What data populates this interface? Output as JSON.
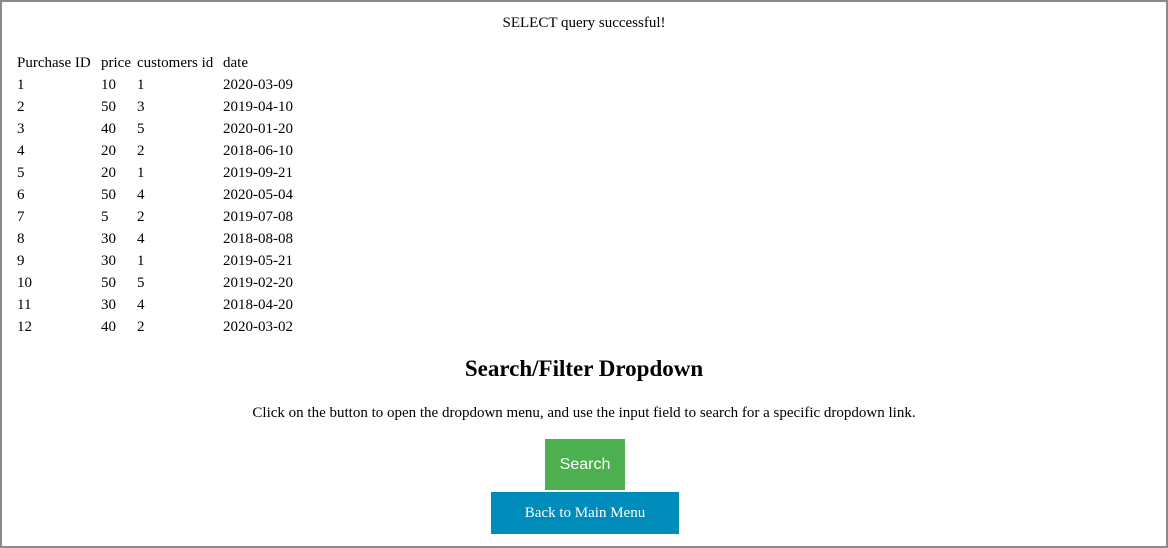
{
  "status_message": "SELECT query successful!",
  "table": {
    "headers": [
      "Purchase ID",
      "price",
      "customers id",
      "date"
    ],
    "rows": [
      [
        "1",
        "10",
        "1",
        "2020-03-09"
      ],
      [
        "2",
        "50",
        "3",
        "2019-04-10"
      ],
      [
        "3",
        "40",
        "5",
        "2020-01-20"
      ],
      [
        "4",
        "20",
        "2",
        "2018-06-10"
      ],
      [
        "5",
        "20",
        "1",
        "2019-09-21"
      ],
      [
        "6",
        "50",
        "4",
        "2020-05-04"
      ],
      [
        "7",
        "5",
        "2",
        "2019-07-08"
      ],
      [
        "8",
        "30",
        "4",
        "2018-08-08"
      ],
      [
        "9",
        "30",
        "1",
        "2019-05-21"
      ],
      [
        "10",
        "50",
        "5",
        "2019-02-20"
      ],
      [
        "11",
        "30",
        "4",
        "2018-04-20"
      ],
      [
        "12",
        "40",
        "2",
        "2020-03-02"
      ]
    ]
  },
  "dropdown_section": {
    "title": "Search/Filter Dropdown",
    "instructions": "Click on the button to open the dropdown menu, and use the input field to search for a specific dropdown link.",
    "search_button_label": "Search"
  },
  "back_button_label": "Back to Main Menu",
  "colors": {
    "search_button": "#4caf50",
    "back_button": "#008cba",
    "frame_border": "#8a8a8a"
  }
}
